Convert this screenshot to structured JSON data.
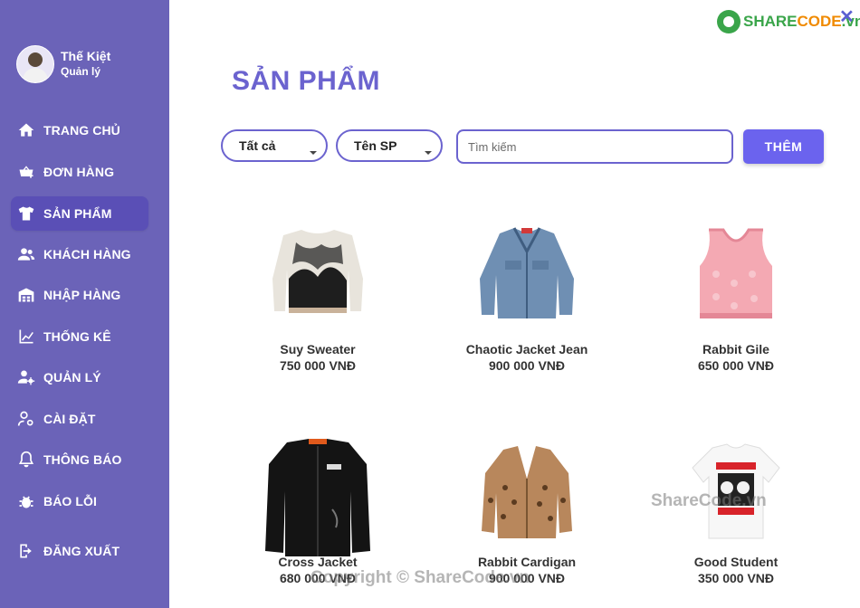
{
  "sidebar": {
    "profile": {
      "name": "Thế Kiệt",
      "role": "Quản lý"
    },
    "items": [
      {
        "label": "TRANG CHỦ",
        "icon": "home-icon",
        "active": false
      },
      {
        "label": "ĐƠN HÀNG",
        "icon": "cart-add-icon",
        "active": false
      },
      {
        "label": "SẢN PHẨM",
        "icon": "shirt-icon",
        "active": true
      },
      {
        "label": "KHÁCH HÀNG",
        "icon": "users-icon",
        "active": false
      },
      {
        "label": "NHẬP HÀNG",
        "icon": "warehouse-icon",
        "active": false
      },
      {
        "label": "THỐNG KÊ",
        "icon": "chart-icon",
        "active": false
      },
      {
        "label": "QUẢN LÝ",
        "icon": "user-gear-icon",
        "active": false
      },
      {
        "label": "CÀI ĐẶT",
        "icon": "user-settings-icon",
        "active": false
      },
      {
        "label": "THÔNG BÁO",
        "icon": "bell-icon",
        "active": false
      },
      {
        "label": "BÁO LỖI",
        "icon": "bug-icon",
        "active": false
      },
      {
        "label": "ĐĂNG XUẤT",
        "icon": "logout-icon",
        "active": false
      }
    ]
  },
  "header": {
    "logo": {
      "part1": "SHARE",
      "part2": "CODE",
      "part3": ".vn"
    },
    "close_label": "✕"
  },
  "main": {
    "title": "SẢN PHẨM",
    "filter_category": "Tất cả",
    "filter_field": "Tên SP",
    "search_placeholder": "Tìm kiếm",
    "add_label": "THÊM"
  },
  "products": [
    {
      "name": "Suy Sweater",
      "price": "750 000 VNĐ"
    },
    {
      "name": "Chaotic Jacket Jean",
      "price": "900 000 VNĐ"
    },
    {
      "name": "Rabbit Gile",
      "price": "650 000 VNĐ"
    },
    {
      "name": "Cross Jacket",
      "price": "680 000 VNĐ"
    },
    {
      "name": "Rabbit Cardigan",
      "price": "900 000 VNĐ"
    },
    {
      "name": "Good Student",
      "price": "350 000 VNĐ"
    }
  ],
  "watermarks": {
    "center": "Copyright © ShareCode.vn",
    "right": "ShareCode.vn"
  },
  "colors": {
    "sidebar": "#6b63b8",
    "accent": "#6b63cf",
    "button": "#6b63ee"
  }
}
